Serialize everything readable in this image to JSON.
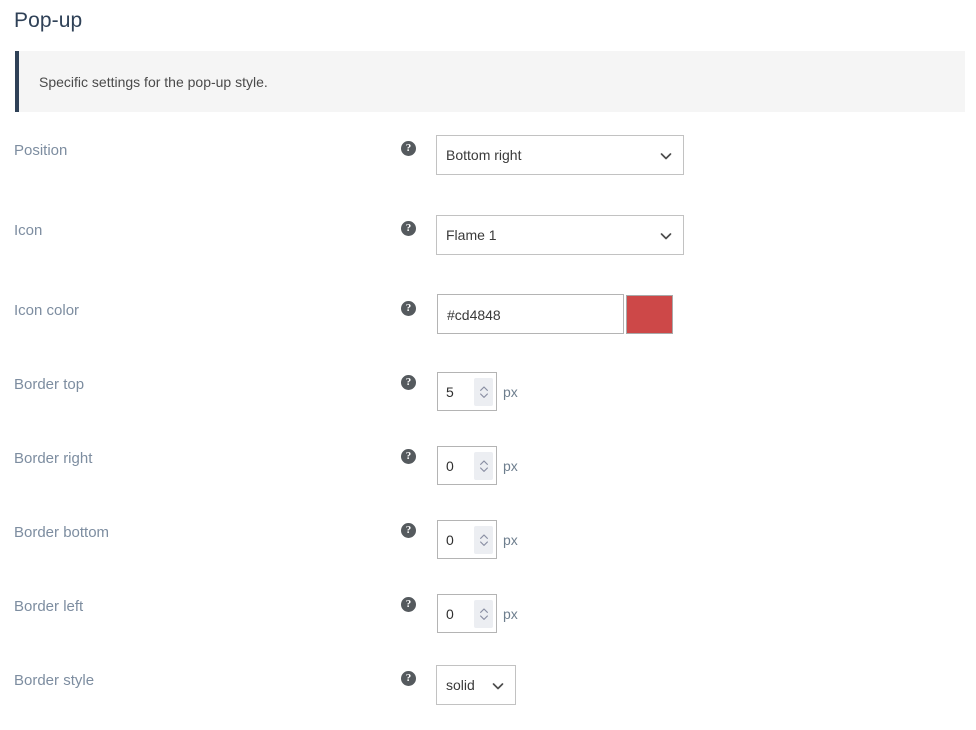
{
  "page": {
    "title": "Pop-up",
    "info_text": "Specific settings for the pop-up style.",
    "accent_color": "#2f4157",
    "info_background": "#f5f5f5",
    "label_color": "#7d8da0"
  },
  "help_icon_glyph": "?",
  "icons": {
    "help": "help-circle-icon",
    "chevron_down": "chevron-down-icon",
    "spinner_up": "chevron-up-icon",
    "spinner_down": "chevron-down-icon"
  },
  "rows": [
    {
      "id": "position",
      "label": "Position",
      "type": "select",
      "value": "Bottom right",
      "options": [
        "Bottom right"
      ],
      "width": "wide"
    },
    {
      "id": "icon",
      "label": "Icon",
      "type": "select",
      "value": "Flame 1",
      "options": [
        "Flame 1"
      ],
      "width": "wide"
    },
    {
      "id": "icon-color",
      "label": "Icon color",
      "type": "color",
      "value": "#cd4848",
      "swatch_color": "#cd4848"
    },
    {
      "id": "border-top",
      "label": "Border top",
      "type": "number",
      "value": "5",
      "unit": "px"
    },
    {
      "id": "border-right",
      "label": "Border right",
      "type": "number",
      "value": "0",
      "unit": "px"
    },
    {
      "id": "border-bottom",
      "label": "Border bottom",
      "type": "number",
      "value": "0",
      "unit": "px"
    },
    {
      "id": "border-left",
      "label": "Border left",
      "type": "number",
      "value": "0",
      "unit": "px"
    },
    {
      "id": "border-style",
      "label": "Border style",
      "type": "select",
      "value": "solid",
      "options": [
        "solid"
      ],
      "width": "narrow"
    }
  ]
}
